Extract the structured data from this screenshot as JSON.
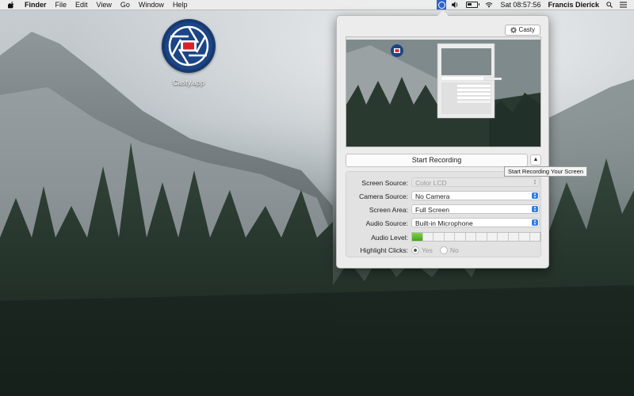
{
  "menubar": {
    "app_name": "Finder",
    "items": [
      "File",
      "Edit",
      "View",
      "Go",
      "Window",
      "Help"
    ],
    "clock": "Sat 08:57:56",
    "user": "Francis Dierick",
    "icons": [
      "apple-icon",
      "casty-menu-icon",
      "volume-icon",
      "battery-icon",
      "wifi-icon",
      "search-icon",
      "list-icon"
    ]
  },
  "desktop": {
    "icon_label": "Casty.app"
  },
  "popover": {
    "casty_button": "Casty",
    "start_recording": "Start Recording",
    "tooltip": "Start Recording Your Screen",
    "settings": {
      "screen_source_label": "Screen Source:",
      "screen_source_value": "Color LCD",
      "camera_source_label": "Camera Source:",
      "camera_source_value": "No Camera",
      "screen_area_label": "Screen Area:",
      "screen_area_value": "Full Screen",
      "audio_source_label": "Audio Source:",
      "audio_source_value": "Built-in Microphone",
      "audio_level_label": "Audio Level:",
      "audio_level_fraction": 0.1,
      "highlight_clicks_label": "Highlight Clicks:",
      "highlight_yes": "Yes",
      "highlight_no": "No"
    }
  },
  "colors": {
    "accent": "#2f7ee8",
    "menu_icon_bg": "#2c64c8",
    "app_icon_bg": "#173a6e",
    "record_red": "#d8212b",
    "level_green": "#5ec02c"
  }
}
